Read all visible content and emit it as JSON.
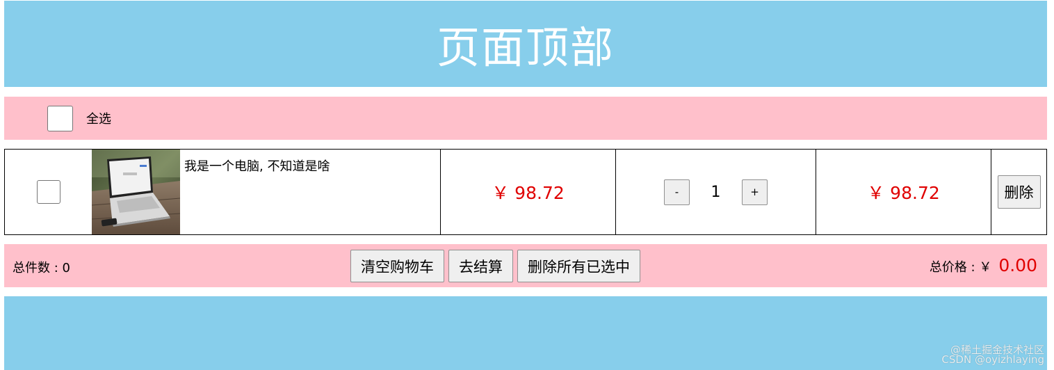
{
  "header": {
    "title": "页面顶部"
  },
  "select_all": {
    "label": "全选",
    "checked": false
  },
  "cart": {
    "items": [
      {
        "checked": false,
        "image_icon": "laptop-photo",
        "name": "我是一个电脑, 不知道是啥",
        "price": "￥ 98.72",
        "quantity": "1",
        "minus_label": "-",
        "plus_label": "+",
        "subtotal": "￥ 98.72",
        "delete_label": "删除"
      }
    ]
  },
  "footer": {
    "total_count_label": "总件数 : 0",
    "clear_label": "清空购物车",
    "checkout_label": "去结算",
    "delete_selected_label": "删除所有已选中",
    "total_price_label": "总价格 : ￥",
    "total_price_value": "0.00"
  },
  "watermark": {
    "line1": "@稀土掘金技术社区",
    "line2": "CSDN @oyizhlaying"
  },
  "colors": {
    "header_bg": "#87ceeb",
    "bar_bg": "#ffc0cb",
    "price": "#e00000"
  }
}
